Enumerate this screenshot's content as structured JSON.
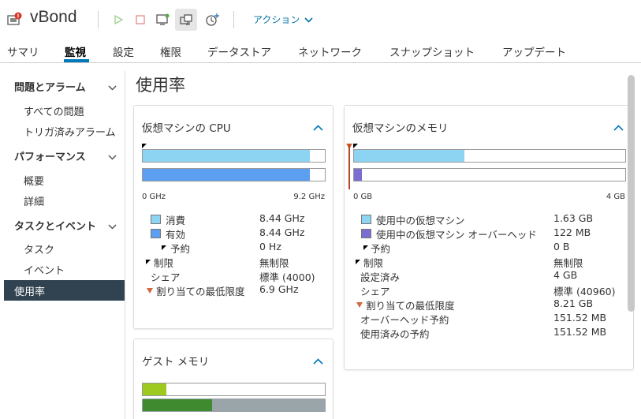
{
  "header": {
    "title": "vBond",
    "actions_label": "アクション"
  },
  "tabs": [
    {
      "label": "サマリ"
    },
    {
      "label": "監視"
    },
    {
      "label": "設定"
    },
    {
      "label": "権限"
    },
    {
      "label": "データストア"
    },
    {
      "label": "ネットワーク"
    },
    {
      "label": "スナップショット"
    },
    {
      "label": "アップデート"
    }
  ],
  "sidebar": {
    "sections": [
      {
        "label": "問題とアラーム",
        "items": [
          "すべての問題",
          "トリガ済みアラーム"
        ]
      },
      {
        "label": "パフォーマンス",
        "items": [
          "概要",
          "詳細"
        ]
      },
      {
        "label": "タスクとイベント",
        "items": [
          "タスク",
          "イベント"
        ]
      }
    ],
    "active_item": "使用率"
  },
  "page_title": "使用率",
  "cpu": {
    "title": "仮想マシンの CPU",
    "axis_min": "0 GHz",
    "axis_max": "9.2 GHz",
    "max_value": 9.2,
    "bar1_value": 8.44,
    "bar2_value": 8.44,
    "bar1_color": "#8dd3f2",
    "bar2_color": "#5c9ef0",
    "rows": [
      {
        "label": "消費",
        "value": "8.44 GHz"
      },
      {
        "label": "有効",
        "value": "8.44 GHz"
      },
      {
        "label": "予約",
        "value": "0 Hz"
      },
      {
        "label": "制限",
        "value": "無制限"
      },
      {
        "label": "シェア",
        "value": "標準 (4000)"
      },
      {
        "label": "割り当ての最低限度",
        "value": "6.9 GHz"
      }
    ]
  },
  "memory": {
    "title": "仮想マシンのメモリ",
    "axis_min": "0 GB",
    "axis_max": "4 GB",
    "max_value": 4,
    "bar1_value": 1.63,
    "bar2_value": 0.119,
    "bar1_color": "#8dd3f2",
    "bar2_color": "#7a6fd0",
    "rows": [
      {
        "label": "使用中の仮想マシン",
        "value": "1.63 GB"
      },
      {
        "label": "使用中の仮想マシン オーバーヘッド",
        "value": "122 MB"
      },
      {
        "label": "予約",
        "value": "0 B"
      },
      {
        "label": "制限",
        "value": "無制限"
      },
      {
        "label": "設定済み",
        "value": "4 GB"
      },
      {
        "label": "シェア",
        "value": "標準 (40960)"
      },
      {
        "label": "割り当ての最低限度",
        "value": "8.21 GB"
      },
      {
        "label": "オーバーヘッド予約",
        "value": "151.52 MB"
      },
      {
        "label": "使用済みの予約",
        "value": "151.52 MB"
      }
    ]
  },
  "guest_memory": {
    "title": "ゲスト メモリ",
    "bar1_fraction": 0.13,
    "bar2_fraction": 0.38,
    "bar1_color": "#9ec91e",
    "bar2_color": "#3f8a2e"
  }
}
